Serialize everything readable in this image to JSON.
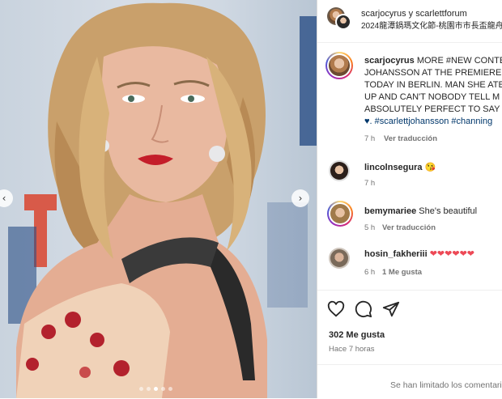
{
  "header": {
    "title": "scarjocyrus y scarlettforum",
    "subtitle": "2024龍潭鍋瑪文化節-桃園市市長盃龍舟"
  },
  "caption": {
    "username": "scarjocyrus",
    "lines": [
      "MORE #NEW CONTE",
      "JOHANSSON AT THE PREMIERE F",
      "TODAY IN BERLIN. MAN SHE ATE",
      "UP AND CAN'T NOBODY TELL M",
      "ABSOLUTELY PERFECT TO SAY TH"
    ],
    "tags_line": "♥. #scarlettjohansson #channing",
    "time": "7 h",
    "translate": "Ver traducción"
  },
  "comments": [
    {
      "username": "lincolnsegura",
      "text": "😘",
      "time": "7 h",
      "action": ""
    },
    {
      "username": "bemymariee",
      "text": "She's beautiful",
      "time": "5 h",
      "action": "Ver traducción"
    },
    {
      "username": "hosin_fakheriii",
      "text": "❤❤❤❤❤❤",
      "time": "6 h",
      "action": "1 Me gusta"
    }
  ],
  "likes": "302 Me gusta",
  "posted": "Hace 7 horas",
  "footer": "Se han limitado los comentarios",
  "colors": {
    "link": "#00376b",
    "heart": "#ed4956",
    "muted": "#737373"
  }
}
